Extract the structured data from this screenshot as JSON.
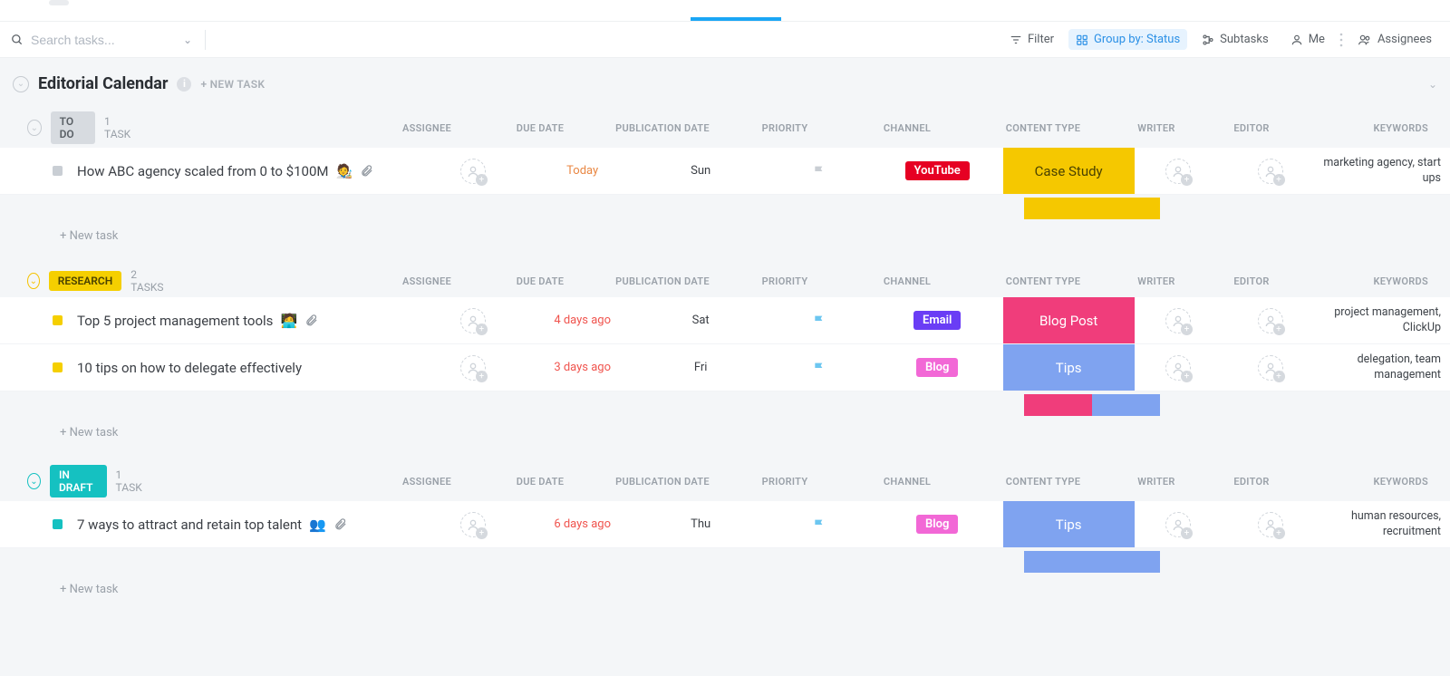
{
  "search": {
    "placeholder": "Search tasks..."
  },
  "toolbar": {
    "filter": "Filter",
    "group_by": "Group by: Status",
    "subtasks": "Subtasks",
    "me": "Me",
    "assignees": "Assignees"
  },
  "list": {
    "title": "Editorial Calendar",
    "new_task": "+ NEW TASK",
    "new_task_row": "+ New task"
  },
  "columns": {
    "assignee": "ASSIGNEE",
    "due": "DUE DATE",
    "pub": "PUBLICATION DATE",
    "prio": "PRIORITY",
    "chan": "CHANNEL",
    "ctype": "CONTENT TYPE",
    "writer": "WRITER",
    "editor": "EDITOR",
    "keywords": "KEYWORDS"
  },
  "groups": [
    {
      "status": "TO DO",
      "status_bg": "#d7dbe0",
      "status_fg": "#5a6066",
      "accent": "gray",
      "count_label": "1 TASK",
      "tasks": [
        {
          "square": "#c9ced4",
          "name": "How ABC agency scaled from 0 to $100M",
          "emoji": "🧑‍🎨",
          "has_attachment": true,
          "due": "Today",
          "due_class": "due-orange",
          "pub": "Sun",
          "flag": "#c9ced4",
          "channel_label": "YouTube",
          "channel_bg": "#e60023",
          "ctype_label": "Case Study",
          "ctype_bg": "#f5c800",
          "ctype_fg": "#4a4200",
          "keywords": "marketing agency, start ups"
        }
      ],
      "summary_strip": [
        {
          "color": "#f5c800",
          "flex": 1
        }
      ]
    },
    {
      "status": "RESEARCH",
      "status_bg": "#f5cf00",
      "status_fg": "#4a4200",
      "accent": "yellow",
      "count_label": "2 TASKS",
      "tasks": [
        {
          "square": "#f5cf00",
          "name": "Top 5 project management tools",
          "emoji": "🧑‍💻",
          "has_attachment": true,
          "due": "4 days ago",
          "due_class": "due-red",
          "pub": "Sat",
          "flag": "#6cc6f0",
          "channel_label": "Email",
          "channel_bg": "#6a3df5",
          "ctype_label": "Blog Post",
          "ctype_bg": "#f03d7b",
          "ctype_fg": "#ffffff",
          "keywords": "project management, ClickUp"
        },
        {
          "square": "#f5cf00",
          "name": "10 tips on how to delegate effectively",
          "emoji": "",
          "has_attachment": false,
          "due": "3 days ago",
          "due_class": "due-red",
          "pub": "Fri",
          "flag": "#6cc6f0",
          "channel_label": "Blog",
          "channel_bg": "#f268d6",
          "ctype_label": "Tips",
          "ctype_bg": "#7fa3f0",
          "ctype_fg": "#ffffff",
          "keywords": "delegation, team management"
        }
      ],
      "summary_strip": [
        {
          "color": "#f03d7b",
          "flex": 1
        },
        {
          "color": "#7fa3f0",
          "flex": 1
        }
      ]
    },
    {
      "status": "IN DRAFT",
      "status_bg": "#15c1c1",
      "status_fg": "#ffffff",
      "accent": "teal",
      "count_label": "1 TASK",
      "tasks": [
        {
          "square": "#15c1c1",
          "name": "7 ways to attract and retain top talent",
          "emoji": "👥",
          "has_attachment": true,
          "due": "6 days ago",
          "due_class": "due-red",
          "pub": "Thu",
          "flag": "#6cc6f0",
          "channel_label": "Blog",
          "channel_bg": "#f268d6",
          "ctype_label": "Tips",
          "ctype_bg": "#7fa3f0",
          "ctype_fg": "#ffffff",
          "keywords": "human resources, recruitment"
        }
      ],
      "summary_strip": [
        {
          "color": "#7fa3f0",
          "flex": 1
        }
      ]
    }
  ]
}
